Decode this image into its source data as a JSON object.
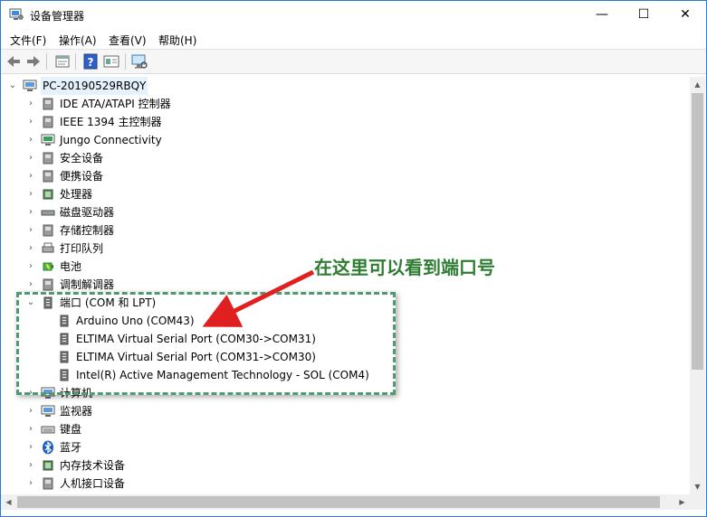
{
  "window": {
    "title": "设备管理器",
    "controls": {
      "minimize": "—",
      "maximize": "☐",
      "close": "✕"
    }
  },
  "menu": [
    "文件(F)",
    "操作(A)",
    "查看(V)",
    "帮助(H)"
  ],
  "toolbar": [
    "back-icon",
    "forward-icon",
    "properties-icon",
    "help-icon",
    "show-hidden-icon",
    "scan-hardware-icon"
  ],
  "tree": {
    "root": {
      "label": "PC-20190529RBQY",
      "expanded": true
    },
    "categories": [
      {
        "label": "IDE ATA/ATAPI 控制器",
        "icon": "ide-controller-icon"
      },
      {
        "label": "IEEE 1394 主控制器",
        "icon": "ieee1394-icon"
      },
      {
        "label": "Jungo Connectivity",
        "icon": "jungo-icon"
      },
      {
        "label": "安全设备",
        "icon": "security-device-icon"
      },
      {
        "label": "便携设备",
        "icon": "portable-device-icon"
      },
      {
        "label": "处理器",
        "icon": "processor-icon"
      },
      {
        "label": "磁盘驱动器",
        "icon": "disk-drive-icon"
      },
      {
        "label": "存储控制器",
        "icon": "storage-controller-icon"
      },
      {
        "label": "打印队列",
        "icon": "print-queue-icon"
      },
      {
        "label": "电池",
        "icon": "battery-icon"
      },
      {
        "label": "调制解调器",
        "icon": "modem-icon"
      },
      {
        "label": "端口 (COM 和 LPT)",
        "icon": "port-icon",
        "expanded": true,
        "children": [
          {
            "label": "Arduino Uno (COM43)",
            "icon": "port-icon"
          },
          {
            "label": "ELTIMA Virtual Serial Port (COM30->COM31)",
            "icon": "port-icon"
          },
          {
            "label": "ELTIMA Virtual Serial Port (COM31->COM30)",
            "icon": "port-icon"
          },
          {
            "label": "Intel(R) Active Management Technology - SOL (COM4)",
            "icon": "port-icon"
          }
        ]
      },
      {
        "label": "计算机",
        "icon": "computer-icon"
      },
      {
        "label": "监视器",
        "icon": "monitor-icon"
      },
      {
        "label": "键盘",
        "icon": "keyboard-icon"
      },
      {
        "label": "蓝牙",
        "icon": "bluetooth-icon"
      },
      {
        "label": "内存技术设备",
        "icon": "memory-tech-icon"
      },
      {
        "label": "人机接口设备",
        "icon": "hid-icon"
      }
    ]
  },
  "annotation": {
    "text": "在这里可以看到端口号",
    "color": "#2e7d32",
    "arrow_color": "#e02020"
  },
  "colors": {
    "accent": "#0078d7",
    "highlight_box": "#4f9b6f",
    "selected_root_bg": "#e5f1fb"
  }
}
